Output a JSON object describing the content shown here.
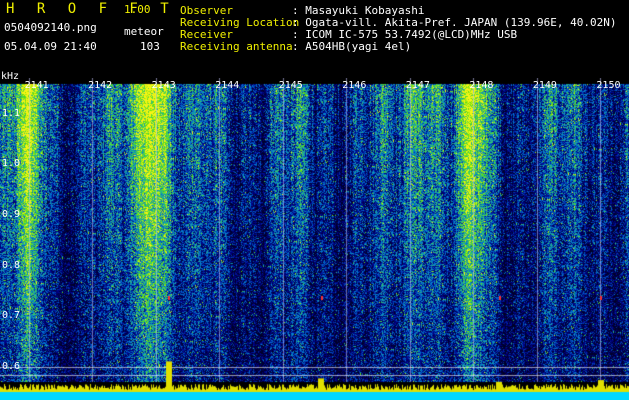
{
  "app": {
    "title": "H R O F F T",
    "version": "1.00",
    "filename": "0504092140.png",
    "mode": "meteor",
    "datetime": "05.04.09 21:40",
    "count": "103"
  },
  "metadata": [
    {
      "label": "Observer",
      "value": ": Masayuki Kobayashi"
    },
    {
      "label": "Receiving Location",
      "value": ": Ogata-vill. Akita-Pref. JAPAN (139.96E, 40.02N)"
    },
    {
      "label": "Receiver",
      "value": ": ICOM IC-575 53.7492(@LCD)MHz USB"
    },
    {
      "label": "Receiving antenna",
      "value": ": A504HB(yagi 4el)"
    }
  ],
  "colors": {
    "label_text": "#f0f000",
    "value_text": "#ffffff",
    "background": "#000000",
    "spectrum_low": "#00008a",
    "spectrum_mid": "#00b0b0",
    "spectrum_high": "#e0e000",
    "baseline": "#00d8ff"
  },
  "chart_data": {
    "type": "heatmap",
    "ylabel": "kHz",
    "y_ticks": [
      "1.1",
      "1.0",
      "0.9",
      "0.8",
      "0.7",
      "0.6"
    ],
    "x_ticks": [
      "2141",
      "2142",
      "2143",
      "2144",
      "2145",
      "2146",
      "2147",
      "2148",
      "2149",
      "2150"
    ],
    "ylim": [
      0.58,
      1.18
    ],
    "xlim": [
      2140.55,
      2150.45
    ],
    "bright_columns": [
      2141.0,
      2142.9,
      2143.0,
      2147.2,
      2148.0
    ],
    "meteor_events": [
      {
        "x": 2143.2,
        "strength": 0.9
      },
      {
        "x": 2145.6,
        "strength": 0.4
      },
      {
        "x": 2148.4,
        "strength": 0.3
      },
      {
        "x": 2150.0,
        "strength": 0.35
      }
    ],
    "grid": true
  }
}
